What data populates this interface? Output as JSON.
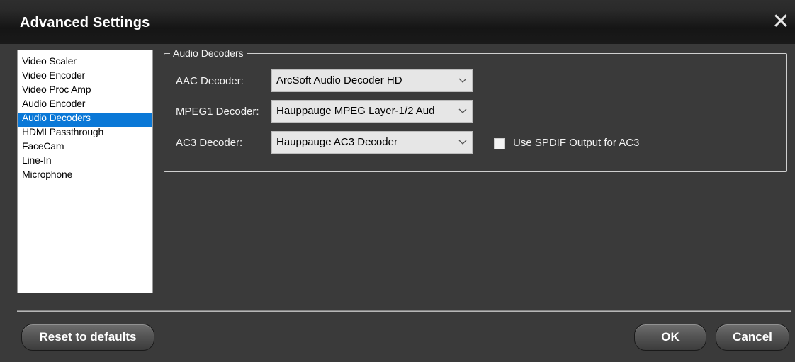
{
  "window": {
    "title": "Advanced Settings",
    "close_icon": "close-icon"
  },
  "sidebar": {
    "items": [
      {
        "label": "Video Scaler",
        "selected": false
      },
      {
        "label": "Video Encoder",
        "selected": false
      },
      {
        "label": "Video Proc Amp",
        "selected": false
      },
      {
        "label": "Audio Encoder",
        "selected": false
      },
      {
        "label": "Audio Decoders",
        "selected": true
      },
      {
        "label": "HDMI Passthrough",
        "selected": false
      },
      {
        "label": "FaceCam",
        "selected": false
      },
      {
        "label": "Line-In",
        "selected": false
      },
      {
        "label": "Microphone",
        "selected": false
      }
    ]
  },
  "audio_decoders": {
    "group_title": "Audio Decoders",
    "aac": {
      "label": "AAC Decoder:",
      "value": "ArcSoft Audio Decoder HD"
    },
    "mpeg1": {
      "label": "MPEG1 Decoder:",
      "value": "Hauppauge MPEG Layer-1/2 Aud"
    },
    "ac3": {
      "label": "AC3 Decoder:",
      "value": "Hauppauge AC3 Decoder"
    },
    "spdif": {
      "label": "Use SPDIF Output for AC3",
      "checked": false
    }
  },
  "footer": {
    "reset_label": "Reset to defaults",
    "ok_label": "OK",
    "cancel_label": "Cancel"
  },
  "colors": {
    "selection": "#0a78d7",
    "background": "#3a3a3a",
    "titlebar": "#1a1a1a"
  }
}
